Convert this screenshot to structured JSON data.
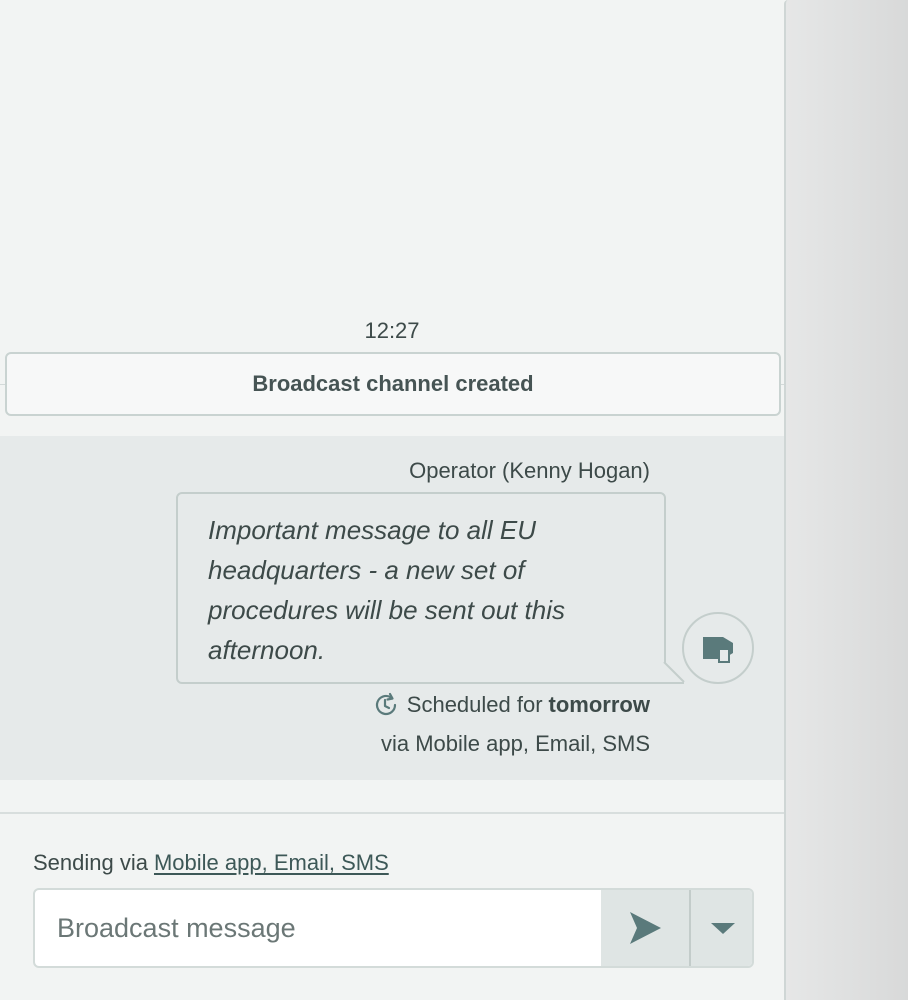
{
  "timeline": {
    "timestamp": "12:27",
    "event_label": "Broadcast channel created"
  },
  "message": {
    "sender": "Operator (Kenny Hogan)",
    "text": "Important message to all EU headquarters - a new set of procedures will be sent out this afternoon.",
    "scheduled_prefix": "Scheduled for",
    "scheduled_when": "tomorrow",
    "via": "via Mobile app, Email, SMS",
    "icons": {
      "status": "megaphone-icon",
      "schedule": "clock-icon"
    }
  },
  "composer": {
    "sending_via_prefix": "Sending via",
    "sending_via_channels": "Mobile app, Email, SMS",
    "placeholder": "Broadcast message",
    "value": "",
    "send_icon": "send-icon",
    "dropdown_icon": "chevron-down-icon"
  },
  "colors": {
    "background": "#f2f4f3",
    "message_area": "#e6eaea",
    "text": "#3d4a49",
    "button_bg": "#dfe5e4",
    "icon": "#5a7a7b"
  }
}
